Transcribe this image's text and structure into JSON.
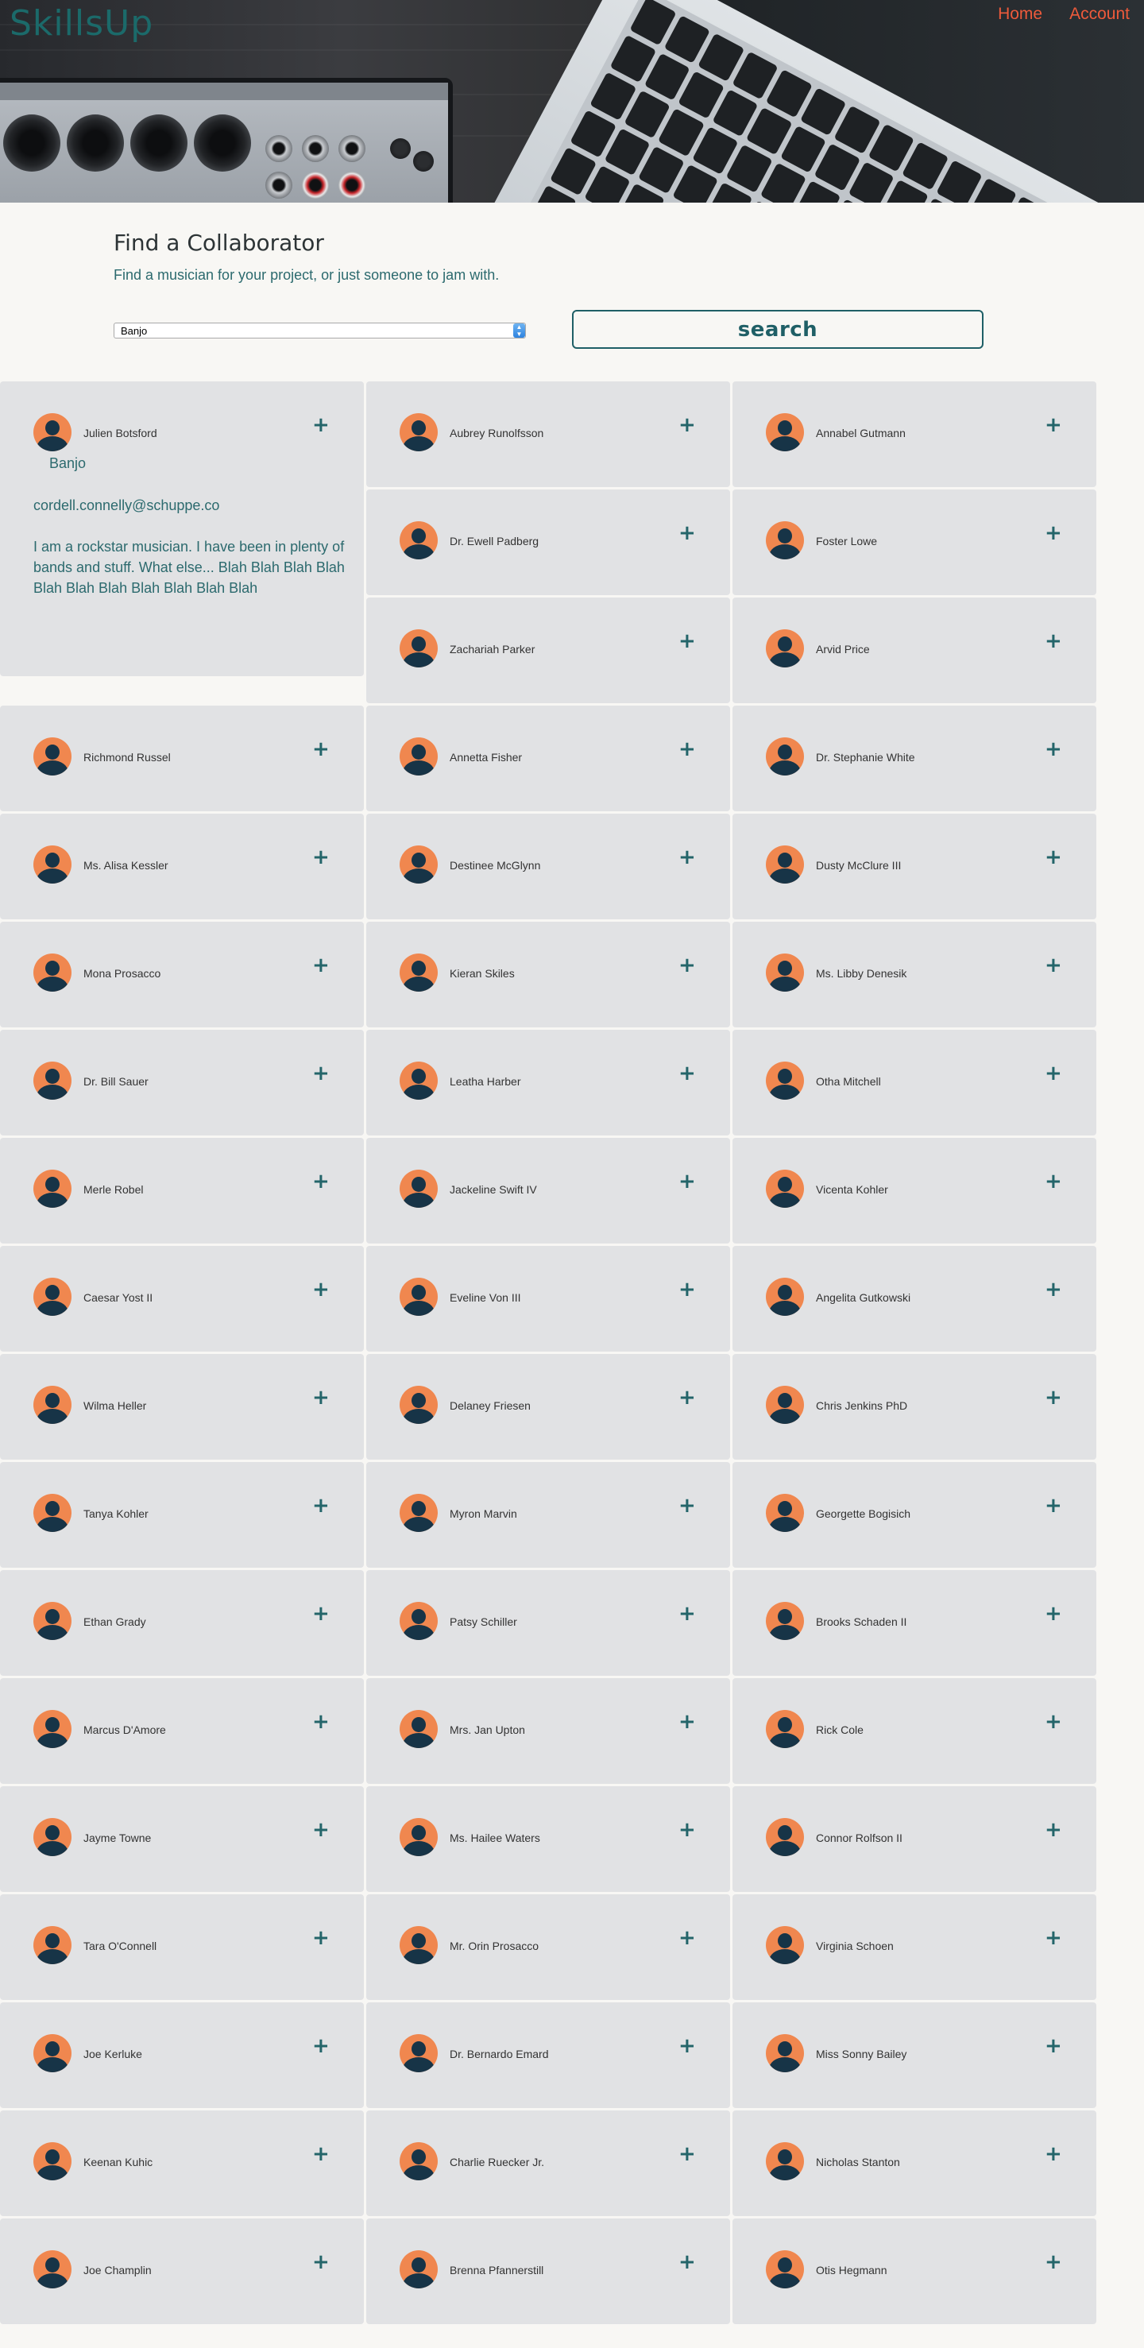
{
  "header": {
    "logo": "SkillsUp",
    "nav": [
      {
        "label": "Home"
      },
      {
        "label": "Account"
      }
    ]
  },
  "search": {
    "title": "Find a Collaborator",
    "subtitle": "Find a musician for your project, or just someone to jam with.",
    "instrument_selected": "Banjo",
    "button_label": "search"
  },
  "expanded": {
    "name": "Julien Botsford",
    "instrument": "Banjo",
    "email": "cordell.connelly@schuppe.co",
    "bio": "I am a rockstar musician. I have been in plenty of bands and stuff. What else... Blah Blah Blah Blah Blah Blah Blah Blah Blah Blah Blah"
  },
  "results": {
    "col1": [
      "Richmond Russel",
      "Ms. Alisa Kessler",
      "Mona Prosacco",
      "Dr. Bill Sauer",
      "Merle Robel",
      "Caesar Yost II",
      "Wilma Heller",
      "Tanya Kohler",
      "Ethan Grady",
      "Marcus D'Amore",
      "Jayme Towne",
      "Tara O'Connell",
      "Joe Kerluke",
      "Keenan Kuhic",
      "Joe Champlin"
    ],
    "col2": [
      "Aubrey Runolfsson",
      "Dr. Ewell Padberg",
      "Zachariah Parker",
      "Annetta Fisher",
      "Destinee McGlynn",
      "Kieran Skiles",
      "Leatha Harber",
      "Jackeline Swift IV",
      "Eveline Von III",
      "Delaney Friesen",
      "Myron Marvin",
      "Patsy Schiller",
      "Mrs. Jan Upton",
      "Ms. Hailee Waters",
      "Mr. Orin Prosacco",
      "Dr. Bernardo Emard",
      "Charlie Ruecker Jr.",
      "Brenna Pfannerstill"
    ],
    "col3": [
      "Annabel Gutmann",
      "Foster Lowe",
      "Arvid Price",
      "Dr. Stephanie White",
      "Dusty McClure III",
      "Ms. Libby Denesik",
      "Otha Mitchell",
      "Vicenta Kohler",
      "Angelita Gutkowski",
      "Chris Jenkins PhD",
      "Georgette Bogisich",
      "Brooks Schaden II",
      "Rick Cole",
      "Connor Rolfson II",
      "Virginia Schoen",
      "Miss Sonny Bailey",
      "Nicholas Stanton",
      "Otis Hegmann"
    ],
    "add_symbol": "+"
  }
}
